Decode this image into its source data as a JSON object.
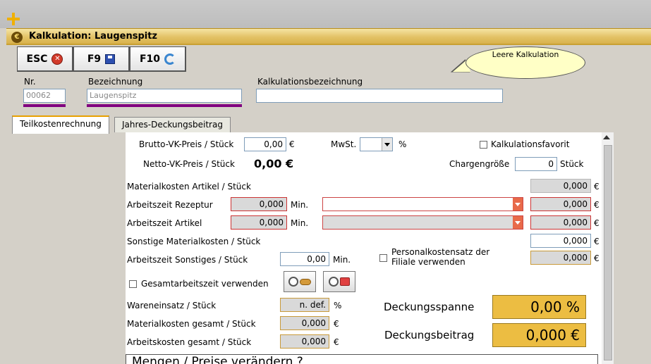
{
  "window": {
    "title": "Kalkulation: Laugenspitz"
  },
  "toolbar": [
    {
      "label": "ESC",
      "icon": "close-icon"
    },
    {
      "label": "F9",
      "icon": "save-icon"
    },
    {
      "label": "F10",
      "icon": "refresh-icon"
    }
  ],
  "tooltip": "Leere Kalkulation",
  "header": {
    "nr_label": "Nr.",
    "nr_value": "00062",
    "bezeichnung_label": "Bezeichnung",
    "bezeichnung_value": "Laugenspitz",
    "kalk_label": "Kalkulationsbezeichnung",
    "kalk_value": ""
  },
  "tabs": [
    "Teilkostenrechnung",
    "Jahres-Deckungsbeitrag"
  ],
  "form": {
    "brutto_label": "Brutto-VK-Preis / Stück",
    "brutto_value": "0,00",
    "euro": "€",
    "mwst_label": "MwSt.",
    "mwst_value": "",
    "pct": "%",
    "favorit_label": "Kalkulationsfavorit",
    "netto_label": "Netto-VK-Preis / Stück",
    "netto_value": "0,00 €",
    "charge_label": "Chargengröße",
    "charge_value": "0",
    "stueck": "Stück",
    "mat_artikel_label": "Materialkosten Artikel / Stück",
    "mat_artikel_value": "0,000",
    "az_rezeptur_label": "Arbeitszeit Rezeptur",
    "az_rezeptur_value": "0,000",
    "min": "Min.",
    "az_rezeptur_cost": "0,000",
    "az_artikel_label": "Arbeitszeit Artikel",
    "az_artikel_value": "0,000",
    "az_artikel_cost": "0,000",
    "sonst_mat_label": "Sonstige Materialkosten / Stück",
    "sonst_mat_value": "0,000",
    "az_sonst_label": "Arbeitszeit Sonstiges / Stück",
    "az_sonst_value": "0,00",
    "personal_label": "Personalkostensatz der Filiale verwenden",
    "personal_value": "0,000",
    "gesamt_label": "Gesamtarbeitszeit verwenden",
    "wareneinsatz_label": "Wareneinsatz / Stück",
    "wareneinsatz_value": "n. def.",
    "mat_gesamt_label": "Materialkosten gesamt / Stück",
    "mat_gesamt_value": "0,000",
    "arbeit_gesamt_label": "Arbeitskosten gesamt / Stück",
    "arbeit_gesamt_value": "0,000",
    "spanne_label": "Deckungsspanne",
    "spanne_value": "0,00 %",
    "beitrag_label": "Deckungsbeitrag",
    "beitrag_value": "0,000 €"
  },
  "bottom_box_title": "Mengen / Preise verändern ?",
  "colors": {
    "accent": "#ecbd42",
    "title_gold": "#e3c266",
    "required_underline": "#800080"
  }
}
